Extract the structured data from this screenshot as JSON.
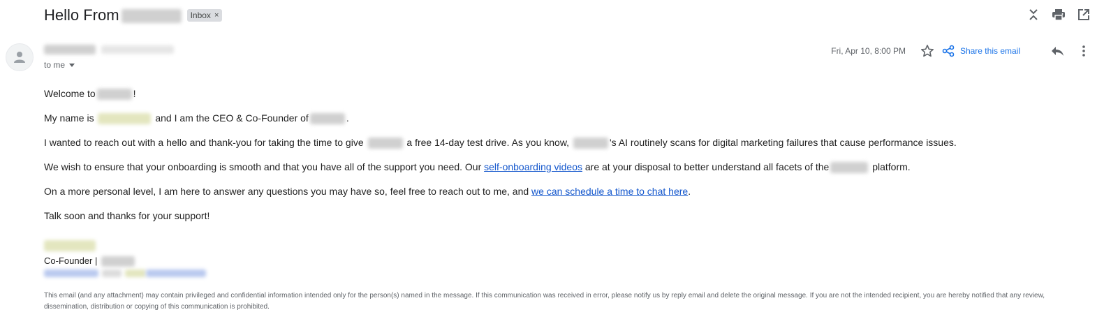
{
  "subject": {
    "title": "Hello From",
    "label_chip": "Inbox",
    "chip_close": "×"
  },
  "toolbar": {
    "icons": [
      "collapse-all-icon",
      "print-icon",
      "open-in-new-window-icon"
    ]
  },
  "sender": {
    "recipient_line": "to me"
  },
  "meta": {
    "date": "Fri, Apr 10, 8:00 PM",
    "share_label": "Share this email"
  },
  "body": {
    "p1_a": "Welcome to",
    "p1_b": "!",
    "p2_a": "My name is",
    "p2_b": "and I am the CEO & Co-Founder of",
    "p2_c": ".",
    "p3_a": "I wanted to reach out with a hello and thank-you for taking the time to give",
    "p3_b": "a free 14-day test drive. As you know,",
    "p3_c": "'s AI routinely scans for digital marketing failures that cause performance issues.",
    "p4_a": "We wish to ensure that your onboarding is smooth and that you have all of the support you need. Our",
    "p4_link": "self-onboarding videos",
    "p4_b": "are at your disposal to better understand all facets of the",
    "p4_c": "platform.",
    "p5_a": "On a more personal level, I am here to answer any questions you may have so, feel free to reach out to me, and",
    "p5_link": "we can schedule a time to chat here",
    "p5_b": ".",
    "p6": "Talk soon and thanks for your support!"
  },
  "signature": {
    "title": "Co-Founder |"
  },
  "disclaimer": "This email (and any attachment) may contain privileged and confidential information intended only for the person(s) named in the message. If this communication was received in error, please notify us by reply email and delete the original message. If you are not the intended recipient, you are hereby notified that any review, dissemination, distribution or copying of this communication is prohibited.",
  "colors": {
    "link": "#1155cc",
    "accent": "#1a73e8",
    "chip_bg": "#dadce0",
    "muted_text": "#5f6368"
  }
}
